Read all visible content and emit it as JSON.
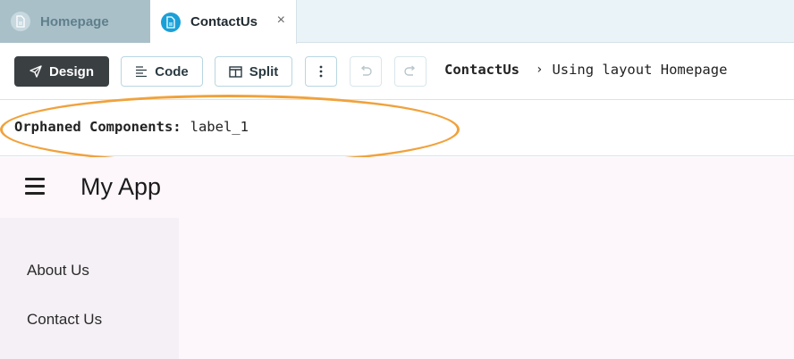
{
  "tabs": [
    {
      "label": "Homepage",
      "icon": "file-icon",
      "active": false
    },
    {
      "label": "ContactUs",
      "icon": "file-icon",
      "active": true,
      "close": "×"
    }
  ],
  "toolbar": {
    "design_label": "Design",
    "code_label": "Code",
    "split_label": "Split",
    "more_icon": "more-vertical-icon",
    "undo_icon": "undo-icon",
    "redo_icon": "redo-icon",
    "breadcrumb": {
      "current": "ContactUs",
      "separator": "›",
      "layout_text": "Using layout Homepage"
    }
  },
  "orphaned": {
    "label": "Orphaned Components:",
    "value": "label_1"
  },
  "app": {
    "title": "My App",
    "nav_items": [
      "About Us",
      "Contact Us"
    ]
  },
  "colors": {
    "accent": "#1aa0d8",
    "highlight": "#f0a23c",
    "design_button": "#3a3f42",
    "inactive_tab": "#a9c0c9"
  }
}
